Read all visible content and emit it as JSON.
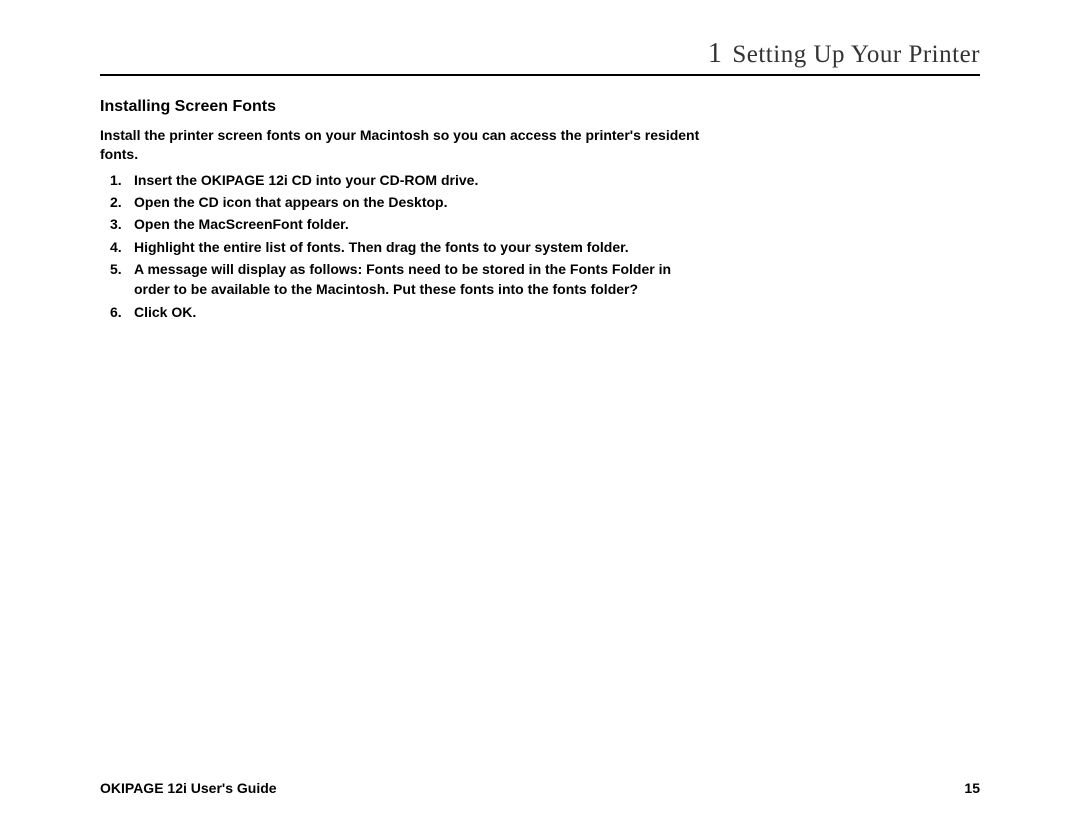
{
  "chapter": {
    "number": "1",
    "title": "Setting Up Your Printer"
  },
  "section": {
    "heading": "Installing Screen Fonts",
    "intro": "Install the printer screen fonts on your Macintosh so you can access the printer's resident fonts.",
    "steps": [
      "Insert the OKIPAGE 12i CD into your CD-ROM drive.",
      "Open the CD icon that appears on the Desktop.",
      "Open the MacScreenFont folder.",
      "Highlight the entire list of fonts.  Then drag the fonts to your system folder.",
      "A message will display as follows:   Fonts need to be stored in the Fonts Folder in order to be  available to the Macintosh.  Put these fonts into the fonts folder?",
      "Click OK."
    ]
  },
  "footer": {
    "product": "OKIPAGE",
    "model": "12i",
    "guide": "User's Guide",
    "page_number": "15"
  }
}
